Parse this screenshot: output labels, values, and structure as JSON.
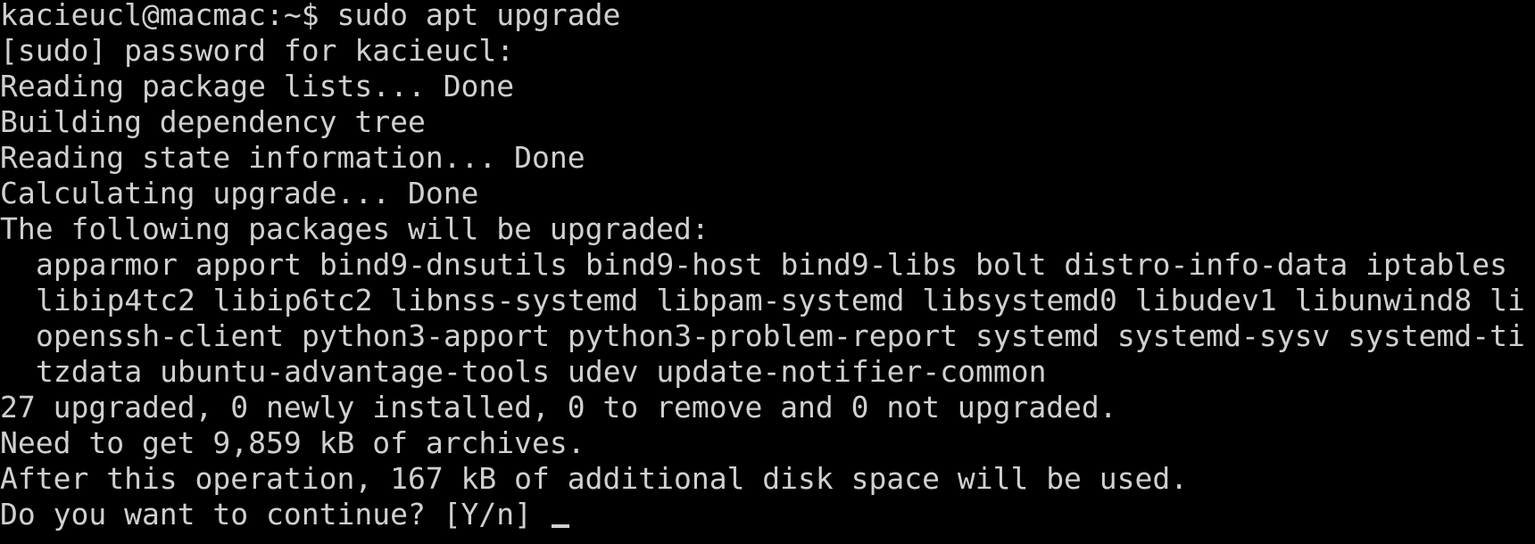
{
  "terminal": {
    "background": "#000000",
    "foreground": "#d0d0d0",
    "lines": [
      "kacieucl@macmac:~$ sudo apt upgrade",
      "[sudo] password for kacieucl:",
      "Reading package lists... Done",
      "Building dependency tree",
      "Reading state information... Done",
      "Calculating upgrade... Done",
      "The following packages will be upgraded:",
      "apparmor apport bind9-dnsutils bind9-host bind9-libs bolt distro-info-data iptables",
      "libip4tc2 libip6tc2 libnss-systemd libpam-systemd libsystemd0 libudev1 libunwind8 li",
      "openssh-client python3-apport python3-problem-report systemd systemd-sysv systemd-ti",
      "tzdata ubuntu-advantage-tools udev update-notifier-common",
      "27 upgraded, 0 newly installed, 0 to remove and 0 not upgraded.",
      "Need to get 9,859 kB of archives.",
      "After this operation, 167 kB of additional disk space will be used.",
      "Do you want to continue? [Y/n] "
    ]
  }
}
